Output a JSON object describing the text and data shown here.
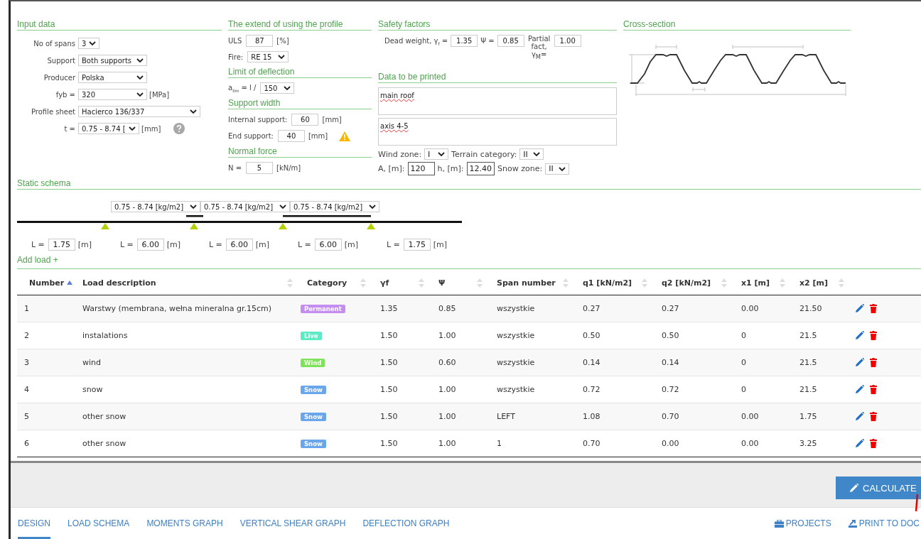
{
  "input_data": {
    "title": "Input data",
    "fields": [
      {
        "label": "No of spans",
        "kind": "select",
        "value": "3"
      },
      {
        "label": "Support",
        "kind": "select",
        "value": "Both supports"
      },
      {
        "label": "Producer",
        "kind": "select",
        "value": "Polska"
      },
      {
        "label": "fyb =",
        "kind": "select",
        "value": "320",
        "unit": "[MPa]"
      },
      {
        "label": "Profile sheet",
        "kind": "select",
        "value": "Hacierco 136/337"
      },
      {
        "label": "t =",
        "kind": "select",
        "value": "0.75 - 8.74 [",
        "unit": "[mm]",
        "help": true
      }
    ]
  },
  "profile_use": {
    "title": "The extend of using the profile",
    "uls": {
      "label": "ULS",
      "value": "87",
      "unit": "[%]"
    },
    "fire": {
      "label": "Fire:",
      "value": "RE 15"
    }
  },
  "deflection": {
    "title": "Limit of deflection",
    "label": "a$_{lim}$ = l /",
    "value": "150"
  },
  "support_width": {
    "title": "Support width",
    "internal": {
      "label": "Internal support:",
      "value": "60",
      "unit": "[mm]"
    },
    "end": {
      "label": "End support:",
      "value": "40",
      "unit": "[mm]",
      "warning": true
    }
  },
  "normal_force": {
    "title": "Normal force",
    "label": "N =",
    "value": "5",
    "unit": "[kN/m]"
  },
  "safety_factors": {
    "title": "Safety factors",
    "dead_weight": {
      "label": "Dead weight, γ$_{f}$ =",
      "value": "1.35"
    },
    "psi": {
      "label": "Ψ =",
      "value": "0.85"
    },
    "partial": {
      "label": "Partial fact, γ$_{M}$=",
      "value": "1.00"
    }
  },
  "print_data": {
    "title": "Data to be printed",
    "lines": [
      "main roof",
      "axis 4-5"
    ]
  },
  "site": {
    "wind_zone": {
      "label": "Wind zone:",
      "value": "I"
    },
    "terrain": {
      "label": "Terrain category:",
      "value": "II"
    },
    "a": {
      "label": "A, [m]:",
      "value": "120"
    },
    "h": {
      "label": "h, [m]:",
      "value": "12.40"
    },
    "snow_zone": {
      "label": "Snow zone:",
      "value": "II"
    }
  },
  "cross_section": {
    "title": "Cross-section"
  },
  "static_schema": {
    "title": "Static schema",
    "span_selects": [
      "0.75 - 8.74 [kg/m2]",
      "0.75 - 8.74 [kg/m2]",
      "0.75 - 8.74 [kg/m2]"
    ],
    "lengths": [
      {
        "label": "L =",
        "value": "1.75",
        "unit": "[m]"
      },
      {
        "label": "L =",
        "value": "6.00",
        "unit": "[m]"
      },
      {
        "label": "L =",
        "value": "6.00",
        "unit": "[m]"
      },
      {
        "label": "L =",
        "value": "6.00",
        "unit": "[m]"
      },
      {
        "label": "L =",
        "value": "1.75",
        "unit": "[m]"
      }
    ],
    "add_load": "Add load +"
  },
  "table": {
    "columns": [
      {
        "label": "Number",
        "sorted": true
      },
      {
        "label": "Load description",
        "sorted": false
      },
      {
        "label": "Category",
        "sorted": false
      },
      {
        "label": "γf",
        "sorted": false
      },
      {
        "label": "Ψ",
        "sorted": false
      },
      {
        "label": "Span number",
        "sorted": false
      },
      {
        "label": "q1 [kN/m2]",
        "sorted": false
      },
      {
        "label": "q2 [kN/m2]",
        "sorted": false
      },
      {
        "label": "x1 [m]",
        "sorted": false
      },
      {
        "label": "x2 [m]",
        "sorted": false
      }
    ],
    "rows": [
      {
        "cells": [
          "1",
          "Warstwy (membrana, wełna mineralna gr.15cm)"
        ],
        "category": "Permanent",
        "color": "#c48df0",
        "rest": [
          "1.35",
          "0.85",
          "wszystkie",
          "0.27",
          "0.27",
          "0.00",
          "21.50"
        ]
      },
      {
        "cells": [
          "2",
          "instalations"
        ],
        "category": "Live",
        "color": "#5cebc4",
        "rest": [
          "1.50",
          "1.00",
          "wszystkie",
          "0.50",
          "0.50",
          "0",
          "21.5"
        ]
      },
      {
        "cells": [
          "3",
          "wind"
        ],
        "category": "Wind",
        "color": "#7ee25a",
        "rest": [
          "1.50",
          "0.60",
          "wszystkie",
          "0.14",
          "0.14",
          "0",
          "21.5"
        ]
      },
      {
        "cells": [
          "4",
          "snow"
        ],
        "category": "Snow",
        "color": "#6aa6ec",
        "rest": [
          "1.50",
          "1.00",
          "wszystkie",
          "0.72",
          "0.72",
          "0",
          "21.5"
        ]
      },
      {
        "cells": [
          "5",
          "other snow"
        ],
        "category": "Snow",
        "color": "#6aa6ec",
        "rest": [
          "1.50",
          "1.00",
          "LEFT",
          "1.08",
          "0.70",
          "0.00",
          "1.75"
        ]
      },
      {
        "cells": [
          "6",
          "other snow"
        ],
        "category": "Snow",
        "color": "#6aa6ec",
        "rest": [
          "1.50",
          "1.00",
          "1",
          "0.70",
          "0.00",
          "0.00",
          "3.25"
        ]
      }
    ]
  },
  "calculate_button": "CALCULATE",
  "nav_tabs": [
    {
      "label": "DESIGN",
      "selected": true
    },
    {
      "label": "LOAD SCHEMA",
      "selected": false
    },
    {
      "label": "MOMENTS GRAPH",
      "selected": false
    },
    {
      "label": "VERTICAL SHEAR GRAPH",
      "selected": false
    },
    {
      "label": "DEFLECTION GRAPH",
      "selected": false
    }
  ],
  "nav_actions": [
    {
      "label": "PROJECTS",
      "kind": "projects"
    },
    {
      "label": "PRINT TO DOC",
      "kind": "print"
    }
  ]
}
